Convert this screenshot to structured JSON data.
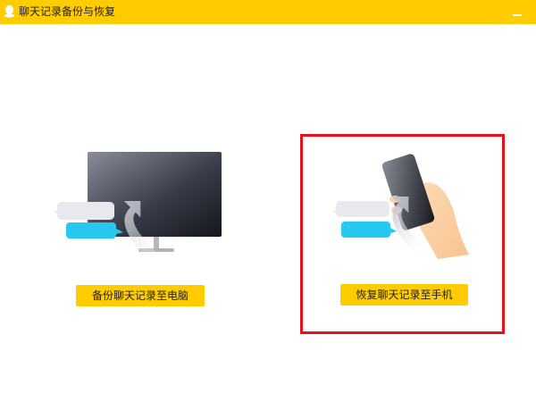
{
  "window": {
    "title": "聊天记录备份与恢复",
    "title_bar_color": "#ffcc00"
  },
  "options": [
    {
      "id": "backup",
      "button_label": "备份聊天记录至电脑",
      "illustration": "monitor-with-upload-arrow"
    },
    {
      "id": "restore",
      "button_label": "恢复聊天记录至手机",
      "illustration": "phone-in-hand-with-upload-arrow"
    }
  ],
  "accents": {
    "button": "#ffcc00",
    "highlight_border": "#e8101a",
    "bubble_cyan": "#27c8f0"
  }
}
